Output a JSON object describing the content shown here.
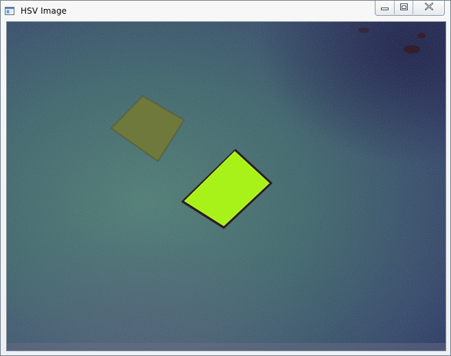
{
  "window": {
    "title": "HSV Image",
    "title_icon": "app-window-icon",
    "buttons": {
      "minimize_icon": "minimize-icon",
      "maximize_icon": "restore-icon",
      "close_icon": "close-icon"
    }
  },
  "image": {
    "colors": {
      "background_teal": "#3f6a6a",
      "background_navy": "#2a3562",
      "olive_square": "#6f7a38",
      "bright_square": "#a8f21a",
      "dark_spot": "#3a1a20"
    }
  }
}
